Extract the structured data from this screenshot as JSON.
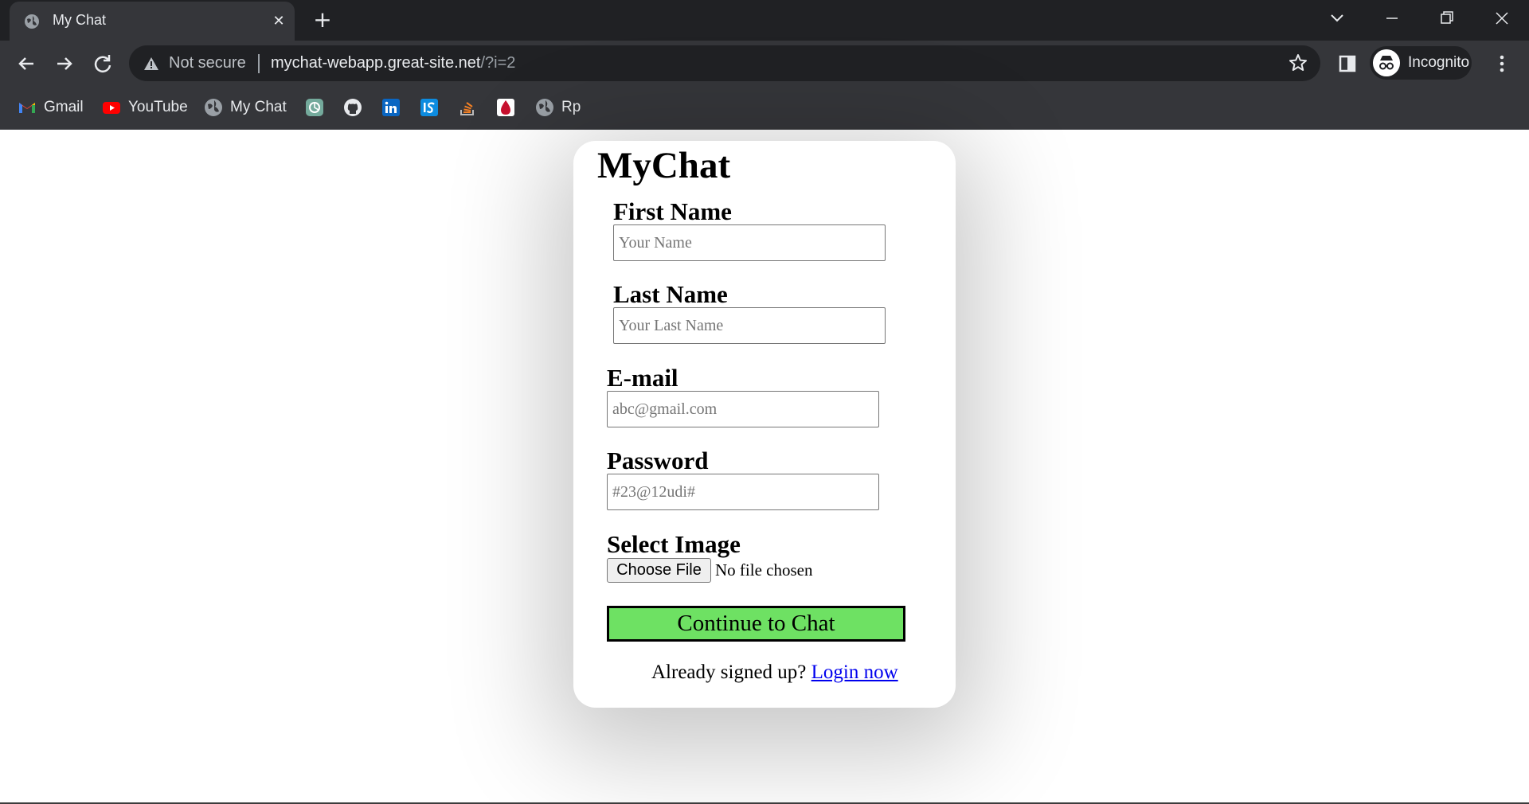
{
  "browser": {
    "tab_title": "My Chat",
    "not_secure_label": "Not secure",
    "url_host": "mychat-webapp.great-site.net",
    "url_path": "/?i=2",
    "profile_label": "Incognito",
    "bookmarks": [
      {
        "label": "Gmail",
        "icon": "gmail-icon"
      },
      {
        "label": "YouTube",
        "icon": "youtube-icon"
      },
      {
        "label": "My Chat",
        "icon": "globe-icon"
      },
      {
        "label": "",
        "icon": "chatgpt-icon"
      },
      {
        "label": "",
        "icon": "github-icon"
      },
      {
        "label": "",
        "icon": "linkedin-icon"
      },
      {
        "label": "",
        "icon": "is-icon"
      },
      {
        "label": "",
        "icon": "stackoverflow-icon"
      },
      {
        "label": "",
        "icon": "blood-drop-icon"
      },
      {
        "label": "Rp",
        "icon": "globe-icon"
      }
    ]
  },
  "form": {
    "title": "MyChat",
    "first_name": {
      "label": "First Name",
      "placeholder": "Your Name"
    },
    "last_name": {
      "label": "Last Name",
      "placeholder": "Your Last Name"
    },
    "email": {
      "label": "E-mail",
      "placeholder": "abc@gmail.com"
    },
    "password": {
      "label": "Password",
      "placeholder": "#23@12udi#"
    },
    "image": {
      "label": "Select Image",
      "button_label": "Choose File",
      "status": "No file chosen"
    },
    "submit_label": "Continue to Chat",
    "already_text": "Already signed up?",
    "login_link": "Login now"
  },
  "colors": {
    "submit_bg": "#6ee163",
    "link": "#0000ee",
    "chrome_dark": "#202124",
    "chrome_toolbar": "#35363a"
  }
}
